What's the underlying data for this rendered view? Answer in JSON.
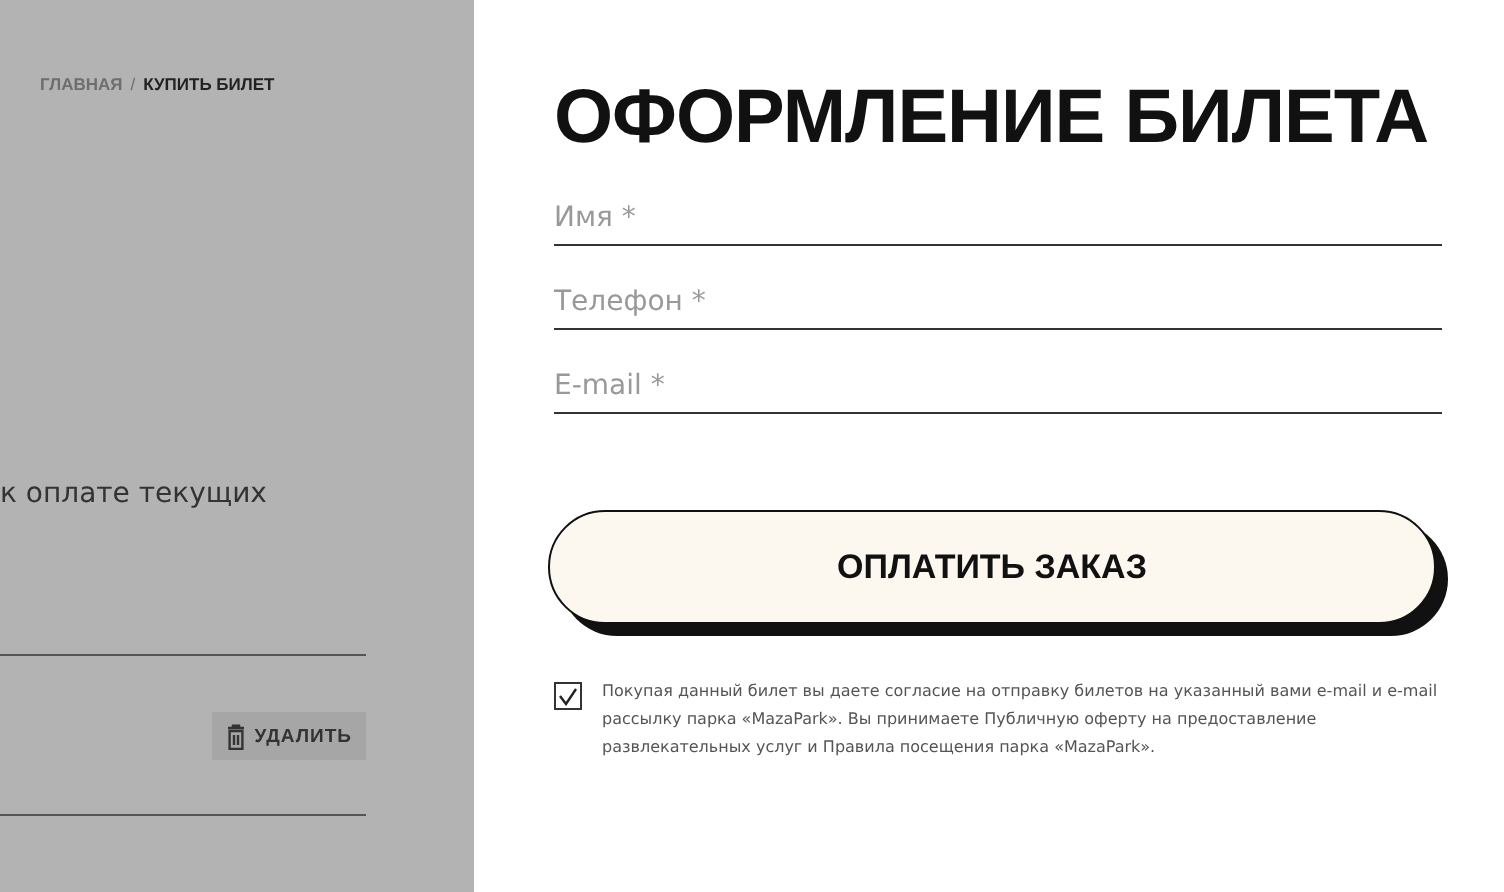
{
  "breadcrumbs": [
    {
      "label": "ГЛАВНАЯ",
      "selected": false
    },
    {
      "label": "КУПИТЬ БИЛЕТ",
      "selected": true
    }
  ],
  "breadcrumb_separator": "/",
  "cart": {
    "note": "к оплате текущих",
    "delete_button": "УДАЛИТЬ"
  },
  "form": {
    "title": "ОФОРМЛЕНИЕ БИЛЕТА",
    "fields": [
      {
        "placeholder": "Имя *"
      },
      {
        "placeholder": "Телефон *"
      },
      {
        "placeholder": "E-mail *"
      }
    ],
    "submit_button": "ОПЛАТИТЬ ЗАКАЗ",
    "consent": {
      "checked": true,
      "text": "Покупая данный билет вы даете согласие на отправку билетов на указанный вами e-mail и e-mail рассылку парка «MazaPark». Вы принимаете Публичную оферту на предоставление развлекательных услуг и Правила посещения парка «MazaPark»."
    }
  }
}
